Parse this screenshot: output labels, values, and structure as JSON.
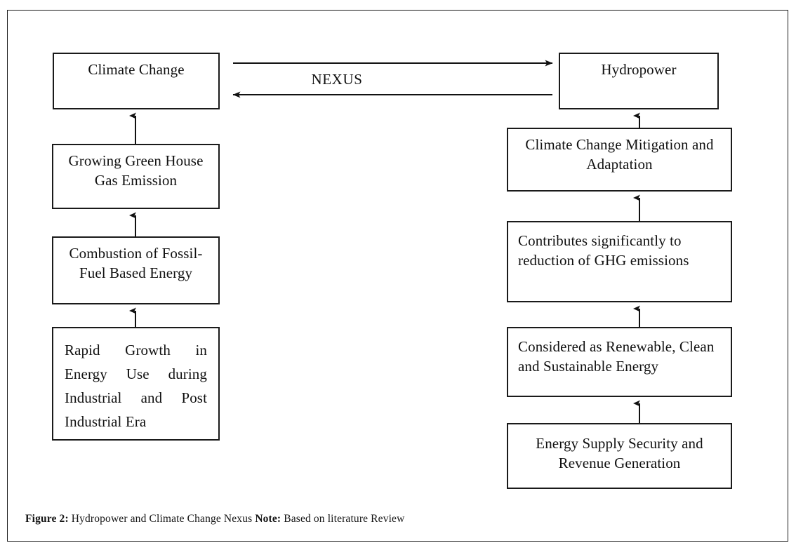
{
  "figure": {
    "caption_prefix": "Figure 2:",
    "caption_main": " Hydropower and Climate Change Nexus ",
    "caption_note_label": "Note:",
    "caption_note_text": " Based on literature Review"
  },
  "diagram": {
    "type": "flowchart",
    "nexus_label": "NEXUS",
    "left_column": {
      "title": "Climate Change causal chain",
      "nodes": [
        {
          "id": "climate-change",
          "text": "Climate Change",
          "align": "center"
        },
        {
          "id": "ghg-emission",
          "text": "Growing Green House\nGas Emission",
          "align": "center"
        },
        {
          "id": "fossil-fuel",
          "text": "Combustion of Fossil-\nFuel Based Energy",
          "align": "center"
        },
        {
          "id": "rapid-growth",
          "text": "Rapid Growth in Energy Use during Industrial and Post Industrial Era",
          "align": "justify"
        }
      ]
    },
    "right_column": {
      "title": "Hydropower benefit chain",
      "nodes": [
        {
          "id": "hydropower",
          "text": "Hydropower",
          "align": "center"
        },
        {
          "id": "mitigation",
          "text": "Climate Change Mitigation and\nAdaptation",
          "align": "center"
        },
        {
          "id": "contributes",
          "text": "Contributes significantly to\nreduction of GHG emissions",
          "align": "left"
        },
        {
          "id": "renewable",
          "text": "Considered as Renewable, Clean\nand Sustainable Energy",
          "align": "left"
        },
        {
          "id": "energy-supply",
          "text": "Energy Supply Security and\nRevenue Generation",
          "align": "center"
        }
      ]
    },
    "connections": [
      {
        "from": "rapid-growth",
        "to": "fossil-fuel",
        "direction": "up"
      },
      {
        "from": "fossil-fuel",
        "to": "ghg-emission",
        "direction": "up"
      },
      {
        "from": "ghg-emission",
        "to": "climate-change",
        "direction": "up"
      },
      {
        "from": "energy-supply",
        "to": "renewable",
        "direction": "up"
      },
      {
        "from": "renewable",
        "to": "contributes",
        "direction": "up"
      },
      {
        "from": "contributes",
        "to": "mitigation",
        "direction": "up"
      },
      {
        "from": "mitigation",
        "to": "hydropower",
        "direction": "up"
      },
      {
        "from": "climate-change",
        "to": "hydropower",
        "direction": "right"
      },
      {
        "from": "hydropower",
        "to": "climate-change",
        "direction": "left"
      }
    ],
    "colors": {
      "stroke": "#1a1a1a",
      "text": "#111111",
      "background": "#ffffff"
    }
  }
}
